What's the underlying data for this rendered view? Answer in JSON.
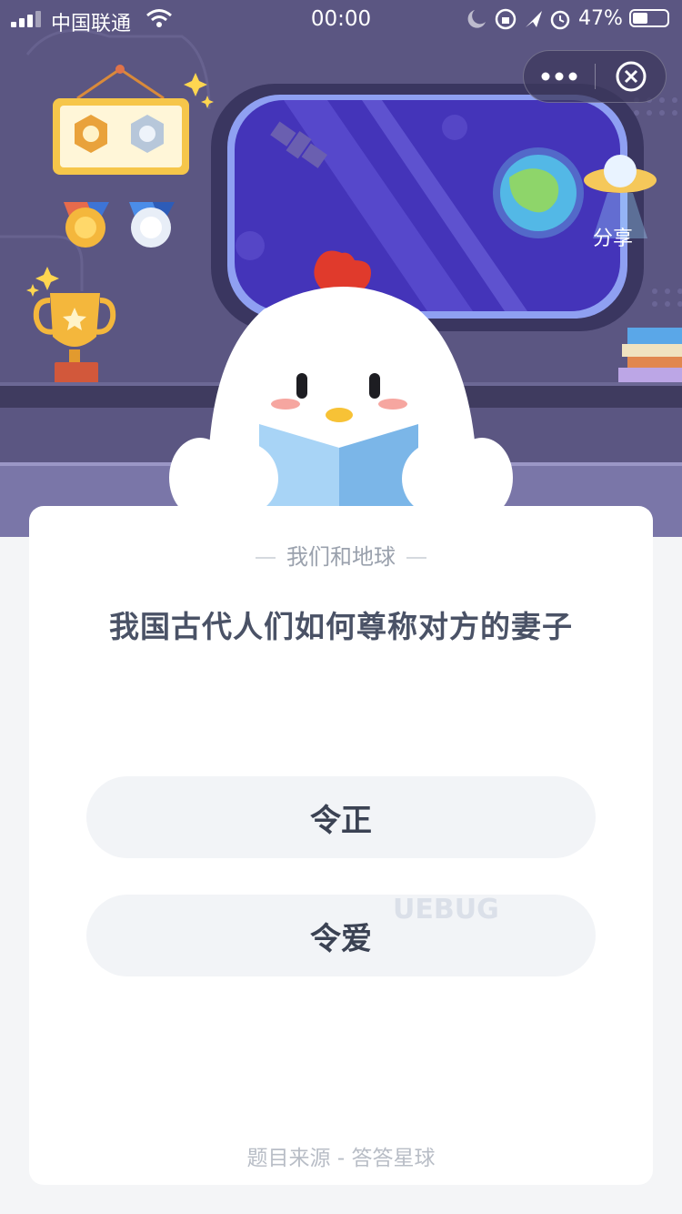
{
  "status_bar": {
    "carrier": "中国联通",
    "time": "00:00",
    "battery_percent": "47%"
  },
  "header": {
    "share_label": "分享"
  },
  "quiz": {
    "category": "我们和地球",
    "question": "我国古代人们如何尊称对方的妻子",
    "options": [
      {
        "label": "令正"
      },
      {
        "label": "令爱"
      }
    ],
    "source": "题目来源 - 答答星球"
  },
  "watermark": "UEBUG",
  "icons": [
    "signal-icon",
    "wifi-icon",
    "moon-icon",
    "orientation-lock-icon",
    "location-icon",
    "alarm-icon",
    "battery-icon",
    "more-icon",
    "close-icon"
  ],
  "colors": {
    "scene_bg": "#5b5682",
    "window_glass": "#4a3cb8",
    "card_bg": "#ffffff",
    "option_bg": "#f2f4f7",
    "question_text": "#4a5266"
  }
}
